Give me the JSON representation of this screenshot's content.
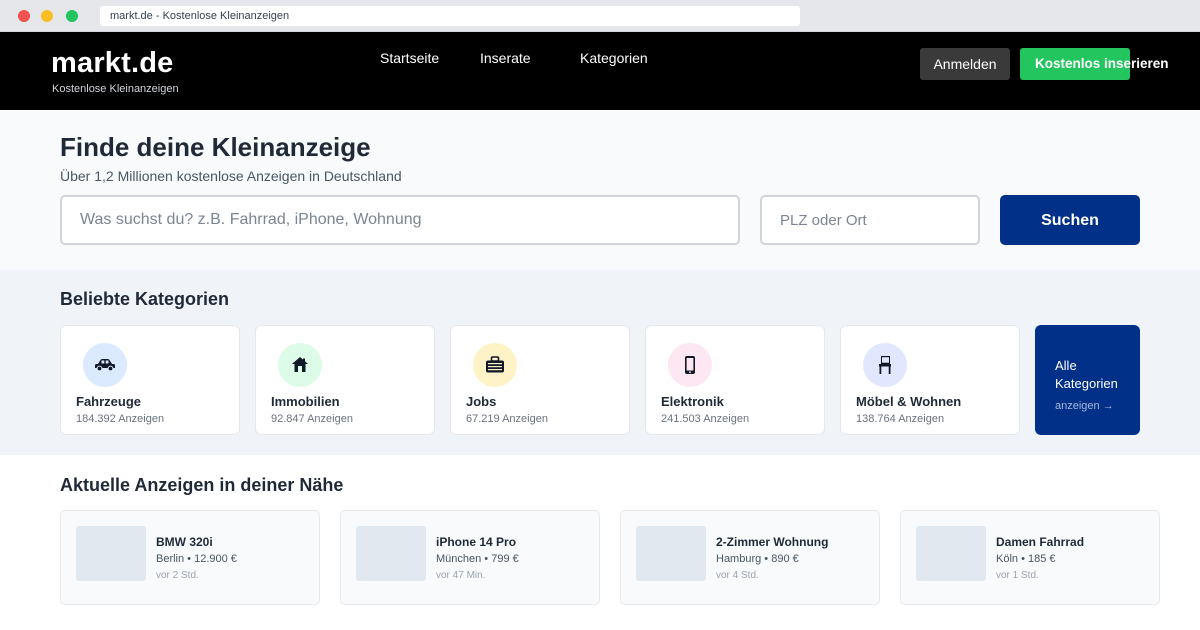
{
  "browser": {
    "url_text": "markt.de - Kostenlose Kleinanzeigen"
  },
  "header": {
    "logo": "markt.de",
    "tagline": "Kostenlose Kleinanzeigen",
    "nav": [
      "Startseite",
      "Inserate",
      "Kategorien"
    ],
    "login_label": "Anmelden",
    "post_label": "Kostenlos inserieren",
    "colors": {
      "background": "#000000",
      "post_button": "#22c55e",
      "login_button": "#3a3a3a"
    }
  },
  "hero": {
    "title": "Finde deine Kleinanzeige",
    "subtitle": "Über 1,2 Millionen kostenlose Anzeigen in Deutschland",
    "search_placeholder": "Was suchst du? z.B. Fahrrad, iPhone, Wohnung",
    "location_placeholder": "PLZ oder Ort",
    "search_button": "Suchen",
    "accent_color": "#003087"
  },
  "categories": {
    "title": "Beliebte Kategorien",
    "items": [
      {
        "name": "Fahrzeuge",
        "count": "184.392 Anzeigen",
        "icon": "car-icon",
        "icon_bg": "#dbeafe"
      },
      {
        "name": "Immobilien",
        "count": "92.847 Anzeigen",
        "icon": "house-icon",
        "icon_bg": "#dcfce7"
      },
      {
        "name": "Jobs",
        "count": "67.219 Anzeigen",
        "icon": "briefcase-icon",
        "icon_bg": "#fef3c7"
      },
      {
        "name": "Elektronik",
        "count": "241.503 Anzeigen",
        "icon": "phone-icon",
        "icon_bg": "#fce7f3"
      },
      {
        "name": "Möbel & Wohnen",
        "count": "138.764 Anzeigen",
        "icon": "chair-icon",
        "icon_bg": "#e0e7ff"
      }
    ],
    "all": {
      "label": "Alle Kategorien",
      "link": "anzeigen →"
    }
  },
  "listings": {
    "title": "Aktuelle Anzeigen in deiner Nähe",
    "items": [
      {
        "title": "BMW 320i",
        "meta": "Berlin • 12.900 €",
        "time": "vor 2 Std."
      },
      {
        "title": "iPhone 14 Pro",
        "meta": "München • 799 €",
        "time": "vor 47 Min."
      },
      {
        "title": "2-Zimmer Wohnung",
        "meta": "Hamburg • 890 €",
        "time": "vor 4 Std."
      },
      {
        "title": "Damen Fahrrad",
        "meta": "Köln • 185 €",
        "time": "vor 1 Std."
      }
    ]
  }
}
